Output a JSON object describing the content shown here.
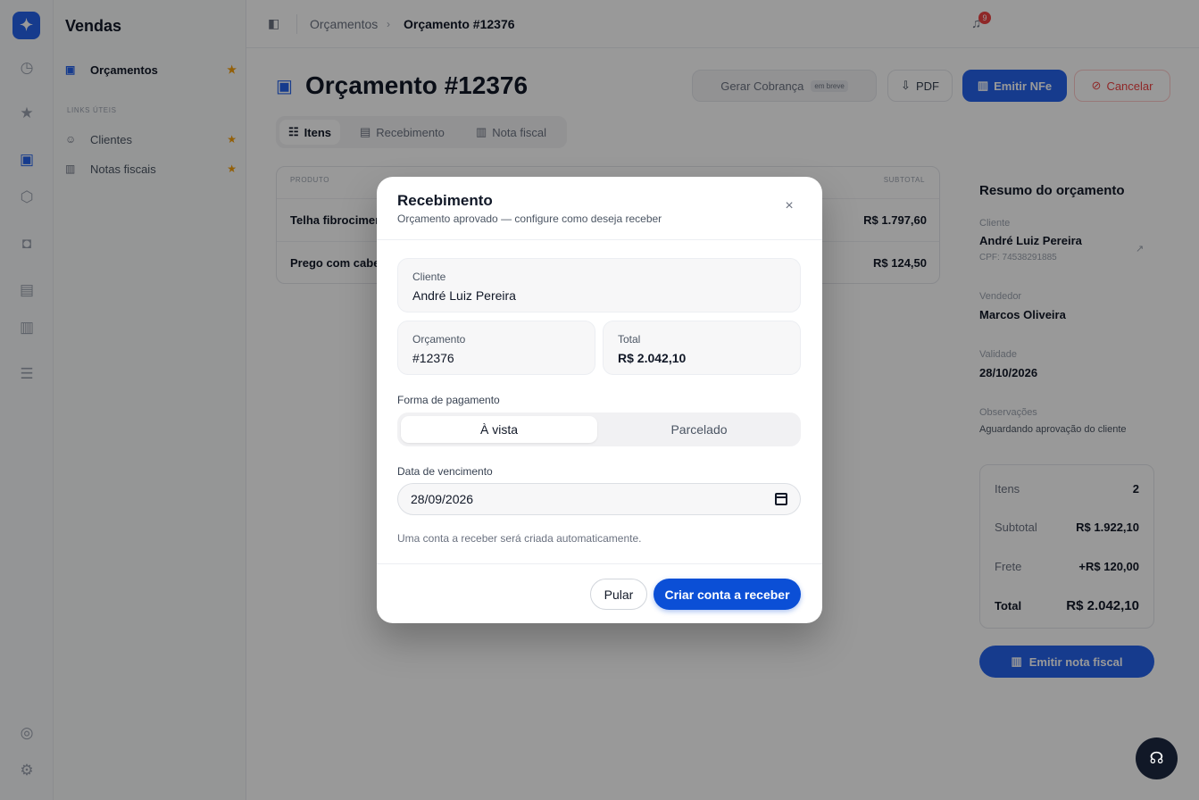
{
  "sidebar": {
    "title": "Vendas",
    "items": [
      {
        "label": "Orçamentos"
      },
      {
        "label": "Clientes"
      },
      {
        "label": "Notas fiscais"
      }
    ],
    "group_label": "LINKS ÚTEIS"
  },
  "topbar": {
    "breadcrumb_parent": "Orçamentos",
    "breadcrumb_current": "Orçamento #12376",
    "notification_count": "9"
  },
  "page": {
    "title": "Orçamento #12376",
    "actions": {
      "gerar": "Gerar Cobrança",
      "gerar_kbd": "em breve",
      "pdf": "PDF",
      "emitir": "Emitir NFe",
      "cancelar": "Cancelar"
    },
    "tabs": [
      "Itens",
      "Recebimento",
      "Nota fiscal"
    ],
    "table": {
      "headers": [
        "PRODUTO",
        "SUBTOTAL"
      ],
      "rows": [
        {
          "produto": "Telha fibrocimento",
          "subtotal": "R$ 1.797,60"
        },
        {
          "produto": "Prego com cabeça",
          "subtotal": "R$ 124,50"
        }
      ]
    }
  },
  "summary": {
    "title": "Resumo do orçamento",
    "cliente_label": "Cliente",
    "cliente": "André Luiz Pereira",
    "cpf": "CPF: 74538291885",
    "vendedor_label": "Vendedor",
    "vendedor": "Marcos Oliveira",
    "validade_label": "Validade",
    "validade": "28/10/2026",
    "obs_label": "Observações",
    "obs": "Aguardando aprovação do cliente",
    "totals": {
      "itens_label": "Itens",
      "itens": "2",
      "subtotal_label": "Subtotal",
      "subtotal": "R$ 1.922,10",
      "frete_label": "Frete",
      "frete": "+R$ 120,00",
      "total_label": "Total",
      "total": "R$ 2.042,10"
    },
    "button": "Emitir nota fiscal"
  },
  "modal": {
    "title": "Recebimento",
    "subtitle": "Orçamento aprovado — configure como deseja receber",
    "cliente_label": "Cliente",
    "cliente": "André Luiz Pereira",
    "orcamento_label": "Orçamento",
    "orcamento": "#12376",
    "total_label": "Total",
    "total": "R$ 2.042,10",
    "forma_label": "Forma de pagamento",
    "forma_options": [
      "À vista",
      "Parcelado"
    ],
    "forma_selected": "À vista",
    "data_label": "Data de vencimento",
    "data_value": "28/09/2026",
    "hint": "Uma conta a receber será criada automaticamente.",
    "skip_button": "Pular",
    "create_button": "Criar conta a receber"
  },
  "colors": {
    "primary": "#0b4fd6",
    "accent_star": "#f59e0b",
    "danger": "#ef4444"
  }
}
